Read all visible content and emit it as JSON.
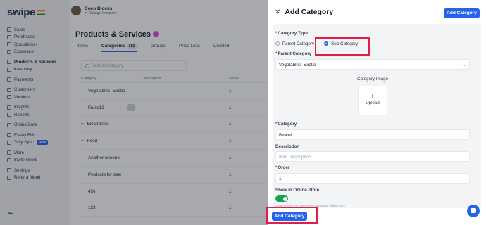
{
  "brand": {
    "name": "swipe"
  },
  "sidebar": {
    "items": [
      {
        "label": "Sales"
      },
      {
        "label": "Purchases"
      },
      {
        "label": "Quotations+"
      },
      {
        "label": "Expenses+"
      },
      {
        "gap": true
      },
      {
        "label": "Products & Services",
        "active": true
      },
      {
        "label": "Inventory"
      },
      {
        "gap": true
      },
      {
        "label": "Payments"
      },
      {
        "gap": true
      },
      {
        "label": "Customers"
      },
      {
        "label": "Vendors"
      },
      {
        "gap": true
      },
      {
        "label": "Insights"
      },
      {
        "label": "Reports"
      },
      {
        "gap": true
      },
      {
        "label": "OnlineStore"
      },
      {
        "gap": true
      },
      {
        "label": "E-way Bills"
      },
      {
        "label": "Tally Sync",
        "badge": "NEW"
      },
      {
        "gap": true
      },
      {
        "label": "More"
      },
      {
        "label": "Invite Users"
      },
      {
        "gap": true
      },
      {
        "label": "Settings"
      },
      {
        "label": "Refer a friend"
      }
    ],
    "collapse_glyph": "⇤"
  },
  "company": {
    "name": "Coco Blocks",
    "sub": "⇄ Change Company"
  },
  "page": {
    "title": "Products & Services"
  },
  "tabs": [
    {
      "label": "Items"
    },
    {
      "label": "Categories",
      "count": "352",
      "active": true
    },
    {
      "label": "Groups"
    },
    {
      "label": "Price Lists"
    },
    {
      "label": "Deleted"
    }
  ],
  "search": {
    "placeholder": "Search Category"
  },
  "table": {
    "headers": [
      "Category",
      "Description",
      "Order"
    ],
    "rows": [
      {
        "name": "Vegetables- Exotic",
        "prefix": "",
        "order": "1"
      },
      {
        "name": "Fruits12",
        "prefix": "",
        "order": "1",
        "thumb": true
      },
      {
        "name": "Electronics",
        "prefix": "+",
        "order": "1"
      },
      {
        "name": "Food",
        "prefix": "+",
        "order": "1"
      },
      {
        "name": "Another oneone",
        "prefix": "",
        "order": "1"
      },
      {
        "name": "Products for sale",
        "prefix": "",
        "order": "1"
      },
      {
        "name": "456",
        "prefix": "",
        "order": "1"
      },
      {
        "name": "123",
        "prefix": "",
        "order": "1"
      }
    ]
  },
  "drawer": {
    "title": "Add Category",
    "close_glyph": "✕",
    "top_button": "Add Category",
    "bottom_button": "Add Category",
    "category_type_label": "Category Type",
    "options": {
      "parent": "Parent Category",
      "sub": "Sub-Category"
    },
    "parent_label": "Parent Category",
    "parent_value": "Vegetables- Exotic",
    "image_label": "Category Image",
    "upload_label": "Upload",
    "category_label": "Category",
    "category_value": "Brocoli",
    "description_label": "Description",
    "description_placeholder": "Item Description",
    "order_label": "Order",
    "order_value": "1",
    "online_label": "Show in Online Store",
    "online_hint": "Show or hide the category in catalogue/ online store"
  },
  "colors": {
    "accent": "#2563eb",
    "highlight": "#e11d48",
    "toggle_on": "#16a34a"
  }
}
